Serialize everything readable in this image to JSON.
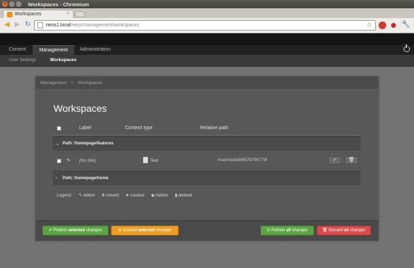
{
  "window": {
    "title": "Workspaces - Chromium"
  },
  "browser": {
    "tab_title": "Workspaces",
    "tab_close": "×",
    "url_host": "neos1.local",
    "url_path": "/neos/management/workspaces"
  },
  "nav": {
    "main_tabs": [
      "Content",
      "Management",
      "Administration"
    ],
    "active_main": "Management",
    "sub_items": [
      "User Settings",
      "Workspaces"
    ],
    "active_sub": "Workspaces"
  },
  "breadcrumb": [
    "Management",
    ">",
    "Workspaces"
  ],
  "page_title": "Workspaces",
  "table": {
    "headers": {
      "label": "Label",
      "content_type": "Content type",
      "relative_path": "Relative path"
    },
    "groups": [
      {
        "path_prefix": "Path:",
        "path": "/homepage/features",
        "expanded": true,
        "rows": [
          {
            "label": "[No title]",
            "content_type": "Text",
            "relative_path": "/main/node506578796779f"
          }
        ]
      },
      {
        "path_prefix": "Path:",
        "path": "/homepage/home",
        "expanded": false,
        "rows": []
      }
    ]
  },
  "legend": {
    "title": "Legend:",
    "items": [
      "edited",
      "moved",
      "created",
      "hidden",
      "deleted"
    ]
  },
  "footer": {
    "publish_selected": {
      "pre": "Publish",
      "bold": "selected",
      "post": "changes"
    },
    "discard_selected": {
      "pre": "Discard",
      "bold": "selected",
      "post": "changes"
    },
    "publish_all": {
      "pre": "Publish",
      "bold": "all",
      "post": "changes"
    },
    "discard_all": {
      "pre": "Discard",
      "bold": "all",
      "post": "changes"
    }
  },
  "colors": {
    "publish": "#5ca542",
    "discard_selected": "#ec9d21",
    "discard_all": "#d94b4b"
  }
}
